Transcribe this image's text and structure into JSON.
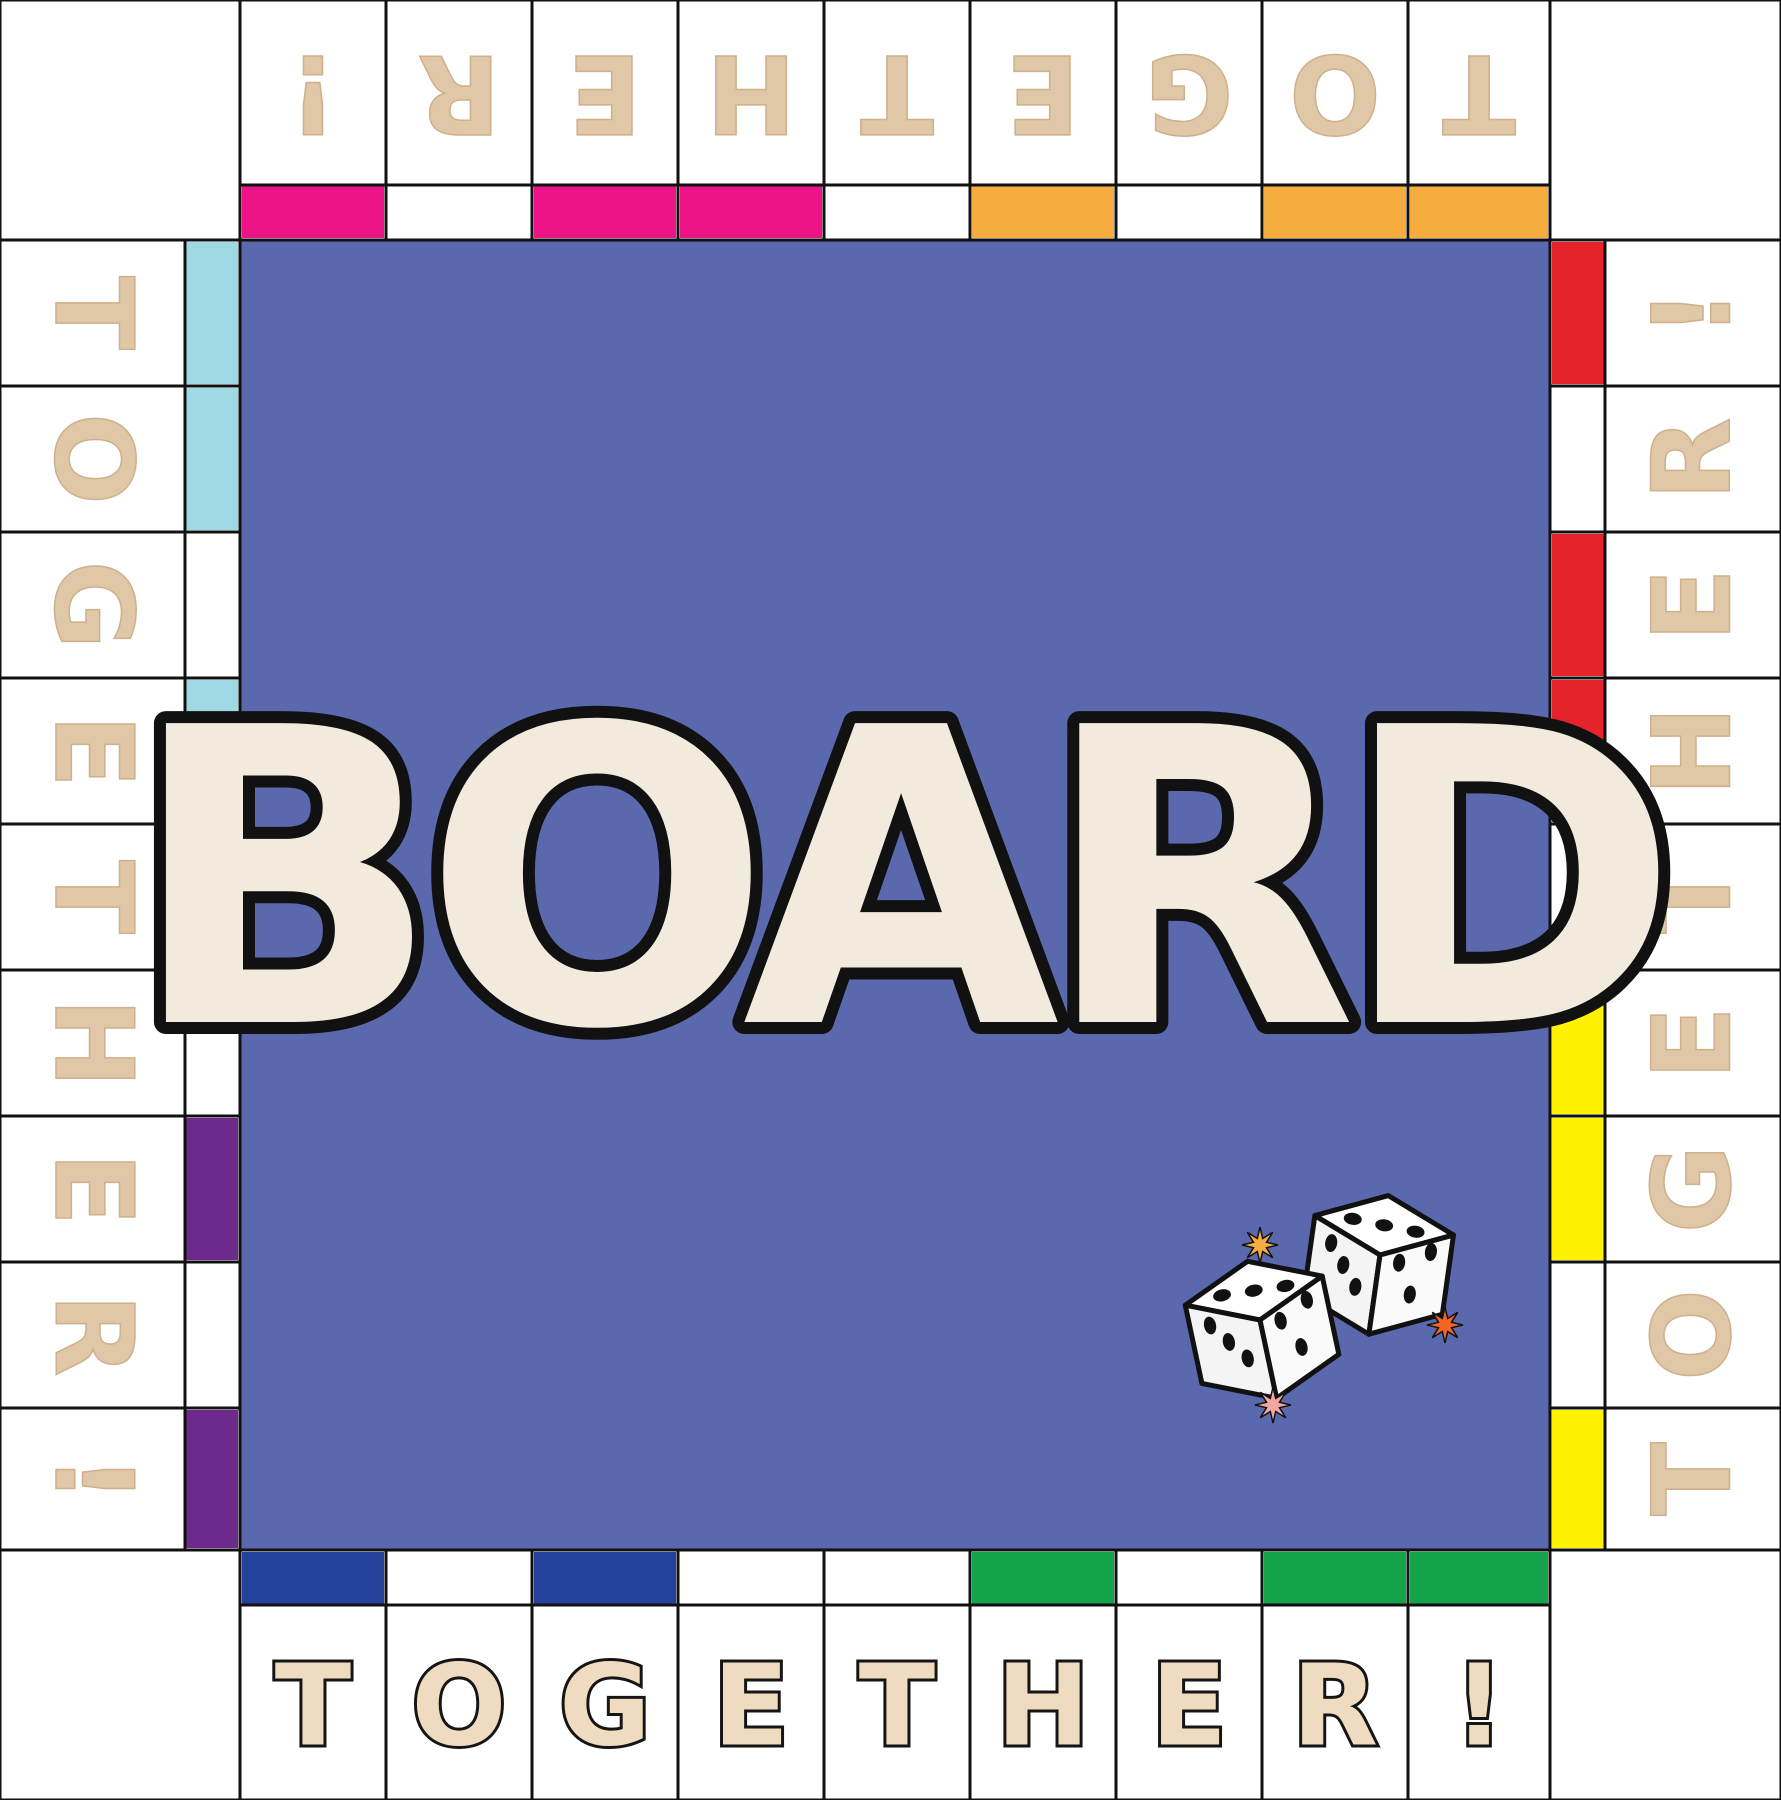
{
  "board": {
    "title": "BOARD",
    "banner_letters": [
      "T",
      "O",
      "G",
      "E",
      "T",
      "H",
      "E",
      "R",
      "!"
    ],
    "corner_labels": {
      "top_left": "",
      "top_right": "",
      "bottom_left": "",
      "bottom_right": ""
    },
    "colors": {
      "center": "#5a68ad",
      "letter_fill": "#e0c7a8",
      "title_fill": "#f2ebdd",
      "outline": "#111111",
      "pink": "#ec1486",
      "orange": "#f6ac3f",
      "light_blue": "#9fd9e4",
      "purple": "#6b2a8c",
      "red": "#e6232a",
      "yellow": "#fff200",
      "navy": "#24419b",
      "green": "#14a24a"
    },
    "sides": {
      "top": {
        "color_groups": [
          "pink",
          "none",
          "pink",
          "pink",
          "none",
          "orange",
          "none",
          "orange",
          "orange"
        ]
      },
      "bottom": {
        "color_groups": [
          "navy",
          "none",
          "navy",
          "none",
          "none",
          "green",
          "none",
          "green",
          "green"
        ]
      },
      "left": {
        "color_groups": [
          "light_blue",
          "light_blue",
          "none",
          "light_blue",
          "none",
          "none",
          "purple",
          "none",
          "purple"
        ]
      },
      "right": {
        "color_groups": [
          "red",
          "none",
          "red",
          "red",
          "none",
          "yellow",
          "yellow",
          "none",
          "yellow"
        ]
      }
    },
    "decoration": {
      "dice_count": 2,
      "die_faces": [
        5,
        5
      ]
    }
  }
}
